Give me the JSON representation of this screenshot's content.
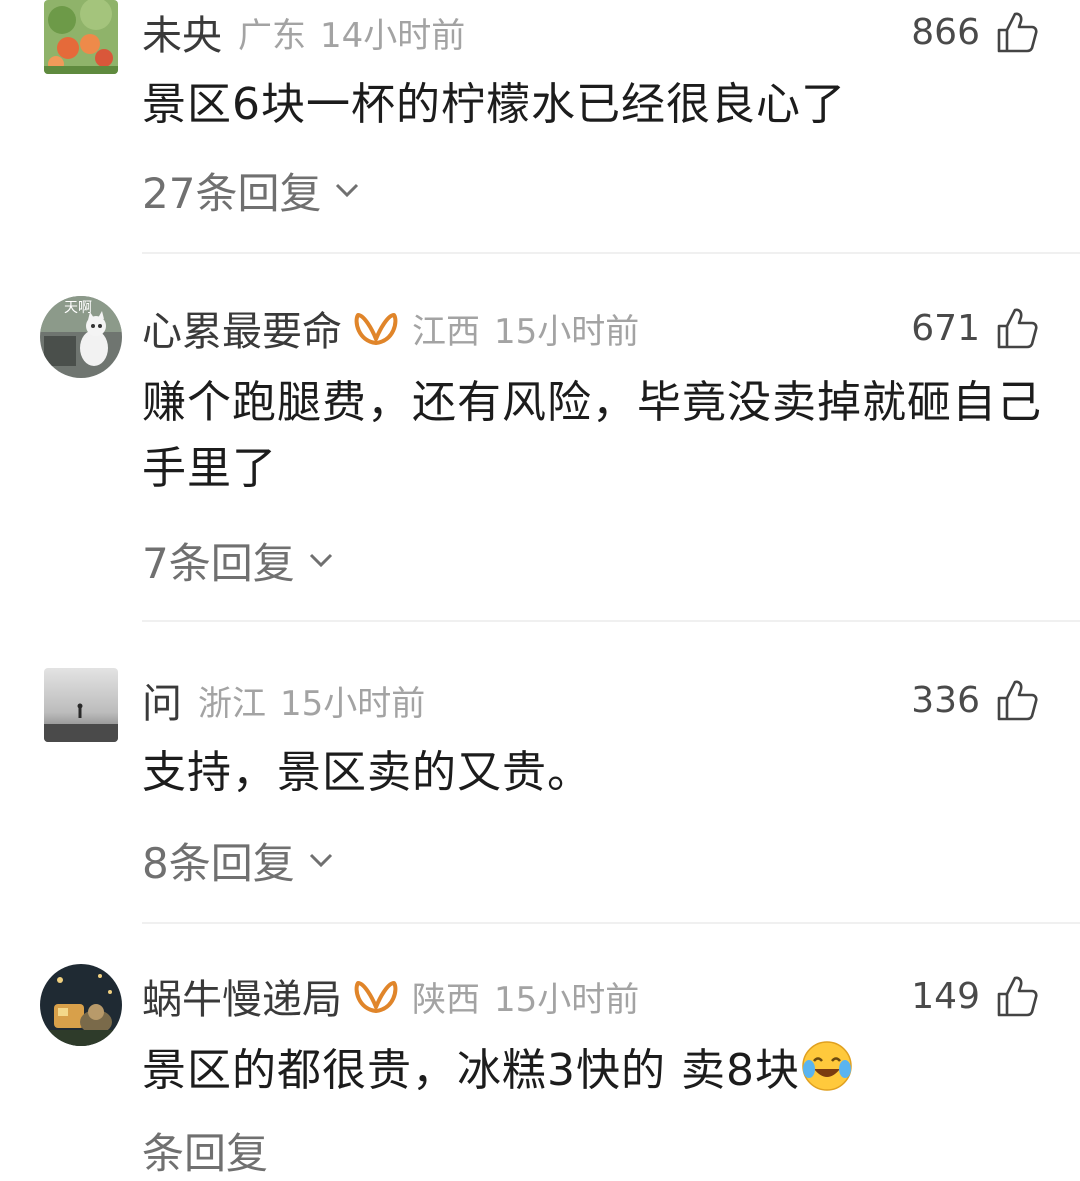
{
  "comments": [
    {
      "username": "未央",
      "location": "广东",
      "time": "14小时前",
      "likes": "866",
      "text": "景区6块一杯的柠檬水已经很良心了",
      "replies": "27条回复",
      "verified": false
    },
    {
      "username": "心累最要命",
      "location": "江西",
      "time": "15小时前",
      "likes": "671",
      "text": "赚个跑腿费，还有风险，毕竟没卖掉就砸自己手里了",
      "replies": "7条回复",
      "verified": true,
      "avatar_text": "天啊"
    },
    {
      "username": "问",
      "location": "浙江",
      "time": "15小时前",
      "likes": "336",
      "text": "支持，景区卖的又贵。",
      "replies": "8条回复",
      "verified": false
    },
    {
      "username": "蜗牛慢递局",
      "location": "陕西",
      "time": "15小时前",
      "likes": "149",
      "text": "景区的都很贵，冰糕3快的 卖8块",
      "replies": "条回复",
      "verified": true,
      "emoji": "laughing-crying-emoji"
    }
  ],
  "colors": {
    "vip_badge": "#e0852a",
    "meta_gray": "#a3a3a3",
    "divider": "#f0f0f0"
  }
}
